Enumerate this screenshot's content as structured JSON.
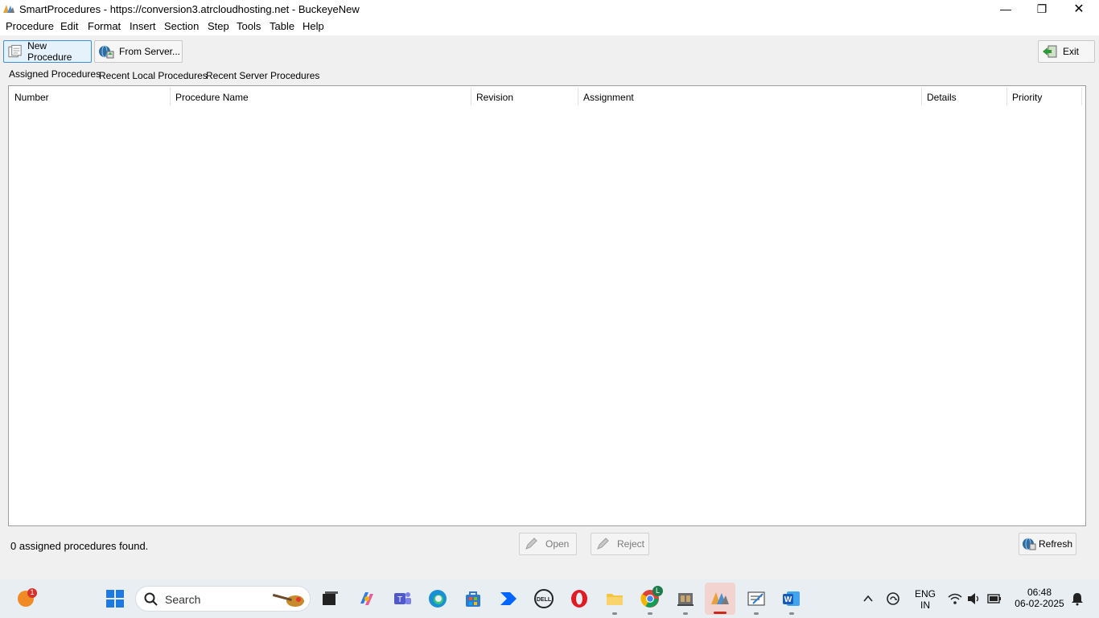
{
  "window": {
    "title": "SmartProcedures - https://conversion3.atrcloudhosting.net - BuckeyeNew",
    "minimize_glyph": "—",
    "maximize_glyph": "❐",
    "close_glyph": "✕"
  },
  "menu": [
    "Procedure",
    "Edit",
    "Format",
    "Insert",
    "Section",
    "Step",
    "Tools",
    "Table",
    "Help"
  ],
  "toolbar": {
    "new_procedure": "New Procedure",
    "from_server": "From Server...",
    "exit": "Exit"
  },
  "tabs": [
    "Assigned Procedures",
    "Recent Local Procedures",
    "Recent Server Procedures"
  ],
  "table": {
    "columns": [
      "Number",
      "Procedure Name",
      "Revision",
      "Assignment",
      "Details",
      "Priority"
    ],
    "rows": []
  },
  "footer": {
    "status": "0 assigned procedures found.",
    "open": "Open",
    "reject": "Reject",
    "refresh": "Refresh"
  },
  "taskbar": {
    "search_label": "Search",
    "notification_badge": "1",
    "chrome_badge": "L",
    "language_line1": "ENG",
    "language_line2": "IN",
    "time": "06:48",
    "date": "06-02-2025"
  },
  "colors": {
    "accent": "#3d8fd6",
    "active_indicator": "#c42b1c",
    "grid_border": "#9c9c9c"
  }
}
